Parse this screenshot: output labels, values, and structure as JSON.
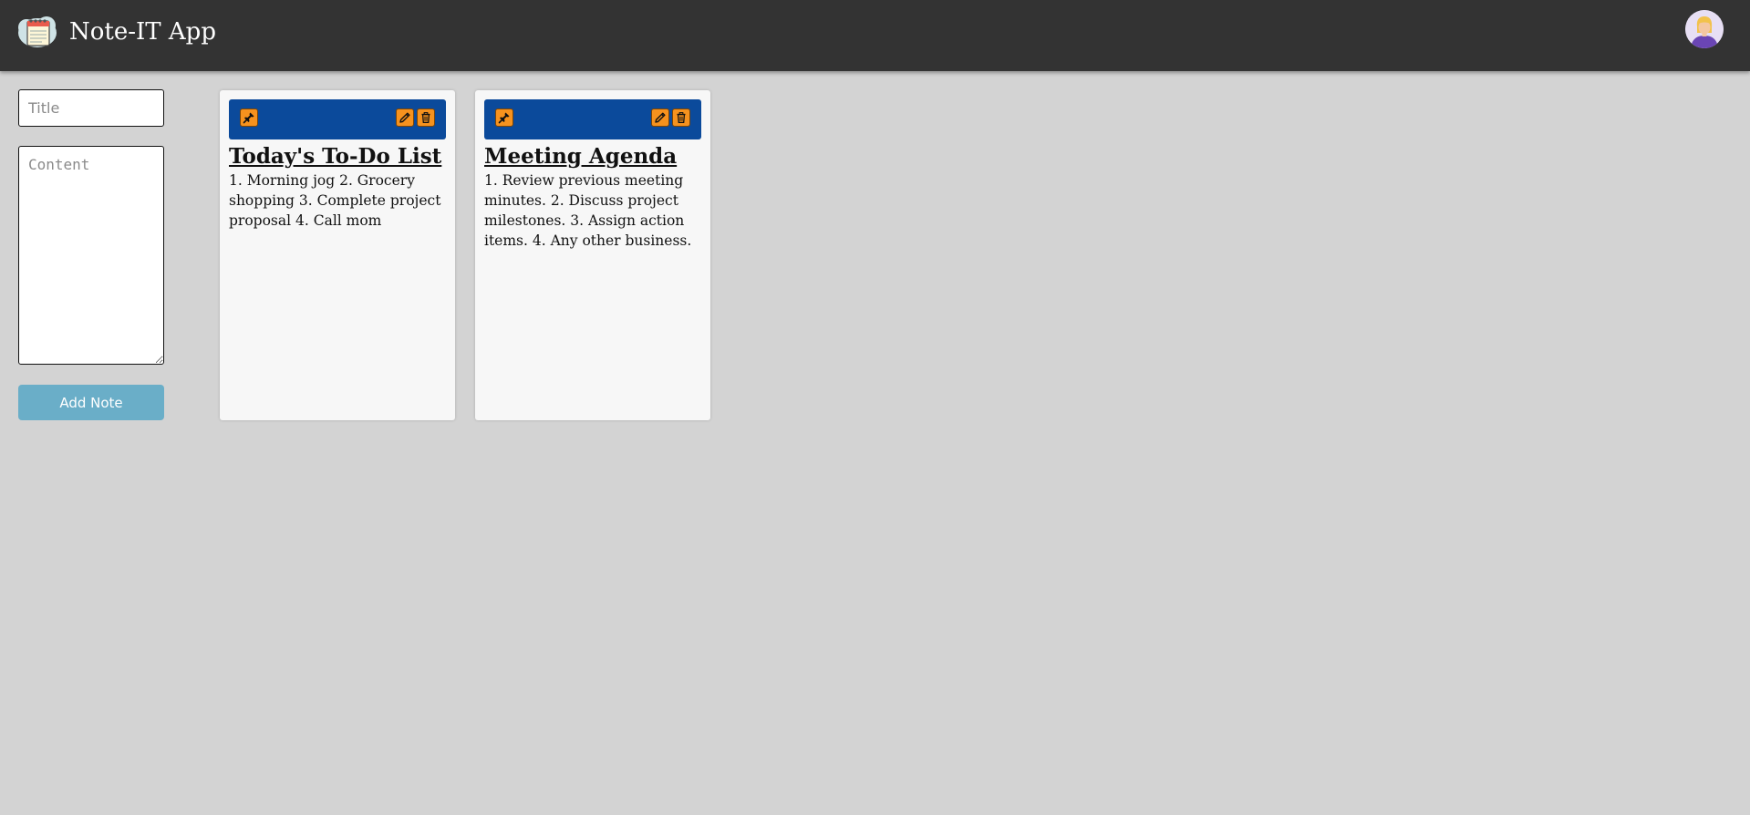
{
  "header": {
    "app_title": "Note-IT App",
    "logo_icon": "notepad-cloud-logo",
    "avatar_icon": "user-avatar-icon"
  },
  "form": {
    "title_placeholder": "Title",
    "title_value": "",
    "content_placeholder": "Content",
    "content_value": "",
    "add_label": "Add Note"
  },
  "notes": [
    {
      "title": "Today's To-Do List",
      "content": "1. Morning jog 2. Grocery shopping 3. Complete project proposal 4. Call mom"
    },
    {
      "title": "Meeting Agenda",
      "content": "1. Review previous meeting minutes. 2. Discuss project milestones. 3. Assign action items. 4. Any other business."
    }
  ],
  "colors": {
    "header_bg": "#333333",
    "page_bg": "#d3d3d3",
    "note_bar": "#0b4a9b",
    "icon_button": "#f6921e",
    "add_button": "#6aaec8"
  }
}
